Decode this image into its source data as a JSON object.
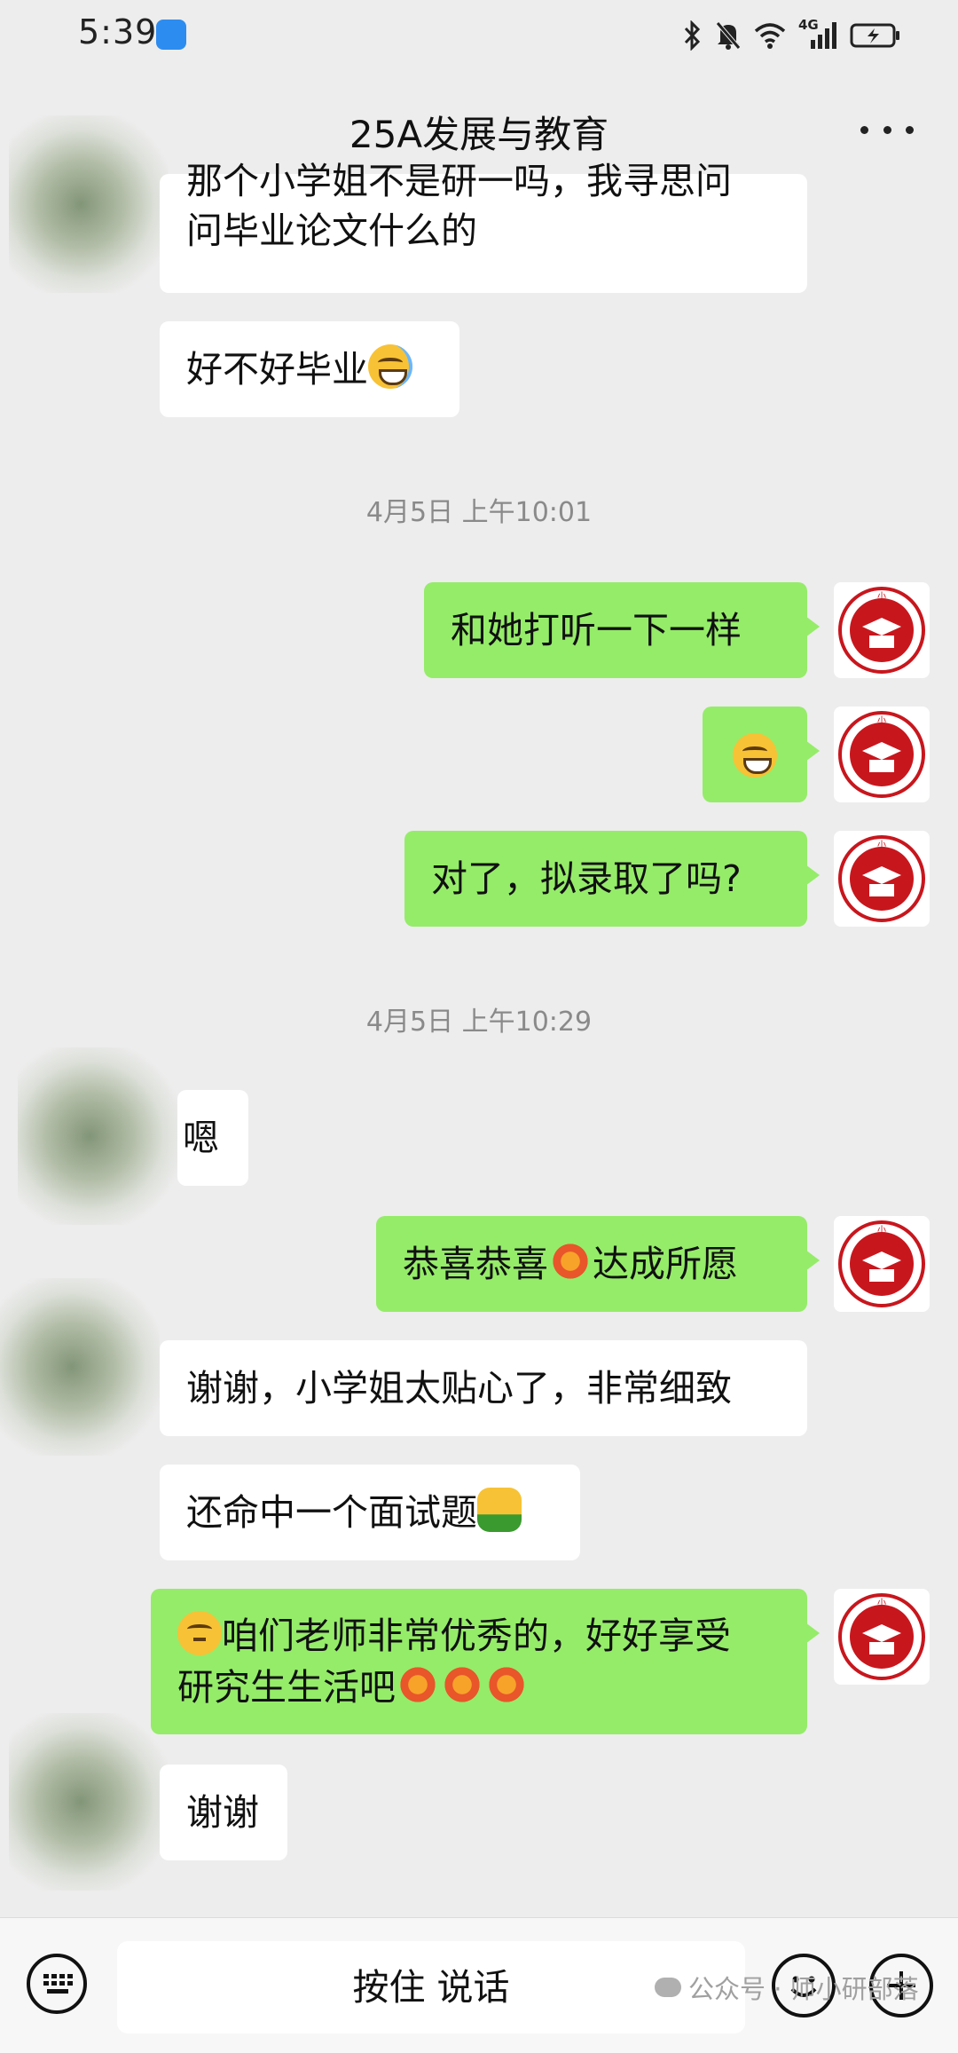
{
  "status_bar": {
    "time": "5:39",
    "network": "4G"
  },
  "header": {
    "title": "25A发展与教育"
  },
  "messages": {
    "m1": {
      "text_line1": "那个小学姐不是研一吗，我寻思问",
      "text_line2": "问毕业论文什么的"
    },
    "m2": {
      "text": "好不好毕业"
    },
    "ts1": {
      "text": "4月5日 上午10:01"
    },
    "m3": {
      "text": "和她打听一下一样"
    },
    "m5": {
      "text": "对了，拟录取了吗?"
    },
    "ts2": {
      "text": "4月5日 上午10:29"
    },
    "m6": {
      "text": "嗯"
    },
    "m7": {
      "text_a": "恭喜恭喜",
      "text_b": "达成所愿"
    },
    "m8": {
      "text": "谢谢，小学姐太贴心了，非常细致"
    },
    "m9": {
      "text": "还命中一个面试题"
    },
    "m10": {
      "text_line1": "咱们老师非常优秀的，好好享受",
      "text_line2": "研究生生活吧"
    },
    "m11": {
      "text": "谢谢"
    }
  },
  "avatar_logo": {
    "chars": [
      "师",
      "小",
      "研"
    ],
    "color": "#c8161d"
  },
  "input_bar": {
    "voice_label": "按住 说话"
  },
  "watermark": {
    "text": "公众号 · 师小研部落"
  },
  "colors": {
    "right_bubble": "#95ec69",
    "left_bubble": "#ffffff",
    "background": "#ededed"
  },
  "icons": {
    "status": [
      "bluetooth-icon",
      "mute-icon",
      "wifi-icon",
      "signal-icon",
      "battery-icon"
    ],
    "header": "more-icon",
    "emojis": [
      "laugh-cry-emoji",
      "grin-emoji",
      "fireworks-emoji",
      "thumbs-up-emoji",
      "thinking-emoji"
    ],
    "input": [
      "keyboard-icon",
      "emoji-icon",
      "plus-icon"
    ]
  }
}
